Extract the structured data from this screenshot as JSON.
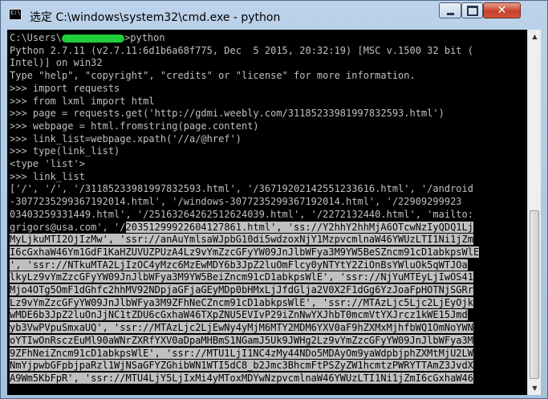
{
  "window": {
    "title": "选定 C:\\windows\\system32\\cmd.exe - python"
  },
  "console": {
    "lines": [
      {
        "text": "C:\\Users\\",
        "redacted": true,
        "after": ">python"
      },
      {
        "text": "Python 2.7.11 (v2.7.11:6d1b6a68f775, Dec  5 2015, 20:32:19) [MSC v.1500 32 bit ("
      },
      {
        "text": "Intel)] on win32"
      },
      {
        "text": "Type \"help\", \"copyright\", \"credits\" or \"license\" for more information."
      },
      {
        "text": ">>> import requests"
      },
      {
        "text": ">>> from lxml import html"
      },
      {
        "text": ">>> page = requests.get('http://gdmi.weebly.com/31185233981997832593.html')"
      },
      {
        "text": ">>> webpage = html.fromstring(page.content)"
      },
      {
        "text": ">>> link_list=webpage.xpath('//a/@href')"
      },
      {
        "text": ">>> type(link_list)"
      },
      {
        "text": "<type 'list'>"
      },
      {
        "text": ">>> link_list"
      },
      {
        "text": "['/', '/', '/31185233981997832593.html', '/36719202142551233616.html', '/android"
      },
      {
        "text": "-3077235299367192014.html', '/windows-3077235299367192014.html', '/22909299923"
      },
      {
        "text": "03403259331449.html', '/25163264262512624039.html', '/2272132440.html', 'mailto:"
      },
      {
        "text": "grigors@usa.com', '/",
        "selected": "20351299922604127861.html', 'ss://Y2hhY2hhMjA6OTcwNzIyQDQ1Lj"
      },
      {
        "text": "MyLjkuMTI2OjIzMw', 'ssr://anAuYmlsaWJpbG10di5wdzoxNjY1MzpvcmlnaW46YWUzLTI1Ni1jZm",
        "full": true
      },
      {
        "text": "I6cGxhaW46Ym1GdF1KaHZUVUZPUzA4Lz9vYmZzcGFyYW09JnJlbWFya3M9YW5BeSZncm91cD1abkpsWlE",
        "full": true
      },
      {
        "text": "', 'ssr://NTkuMTA2LjIzOC4yMzc6MzEwMDY6b3JpZ2luOmFlcy0yNTYtY2ZiOnBsYWluOk5qWTJOa",
        "full": true
      },
      {
        "text": "lkyLz9vYmZzcGFyYW09JnJlbWFya3M9YW5BeiZncm91cD1abkpsWlE', 'ssr://NjYuMTEyLjIwOS41",
        "full": true
      },
      {
        "text": "Mjo4OTg5OmF1dGhfc2hhMV92NDpjaGFjaGEyMDp0bHMxLjJfdGlja2V0X2F1dGg6YzJoaFpHOTNjSGRr",
        "full": true
      },
      {
        "text": "Lz9vYmZzcGFyYW09JnJlbWFya3M9ZFhNeCZncm91cD1abkpsWlE', 'ssr://MTAzLjc5Ljc2LjEyOjk",
        "full": true
      },
      {
        "text": "wMDE6b3JpZ2luOnJjNC1tZDU6cGxhaW46TXpZNU5EVIvP29iZnNwYXJhbT0mcmVtYXJrcz1kWE15Jmd",
        "full": true
      },
      {
        "text": "yb3VwPVpuSmxaUQ', 'ssr://MTAzLjc2LjEwNy4yMjM6MTY2MDM6YXV0aF9hZXMxMjhfbWQ1OmNoYWN",
        "full": true
      },
      {
        "text": "oYTIwOnRsczEuMl90aWNrZXRfYXV0aDpaMHBmS1NGamJ5Uk9JWHg2Lz9vYmZzcGFyYW09JnJlbWFya3M",
        "full": true
      },
      {
        "text": "9ZFhNeiZncm91cD1abkpsWlE', 'ssr://MTU1LjI1NC4zMy44NDo5MDAyOm9yaWdpbjphZXMtMjU2LW",
        "full": true
      },
      {
        "text": "NmYjpwbGFpbjpaRzl1WjNSaGFYZGhibWN1WTI5dC8_b2Jmc3BhcmFtPSZyZW1hcmtzPWRYTTAmZ3JvdX",
        "full": true
      },
      {
        "text": "A9Wm5KbFpR', 'ssr://MTU4LjY5LjIxMi4yMToxMDYwNzpvcmlnaW46YWUzLTI1Ni1jZmI6cGxhaW46",
        "full": true
      }
    ]
  }
}
